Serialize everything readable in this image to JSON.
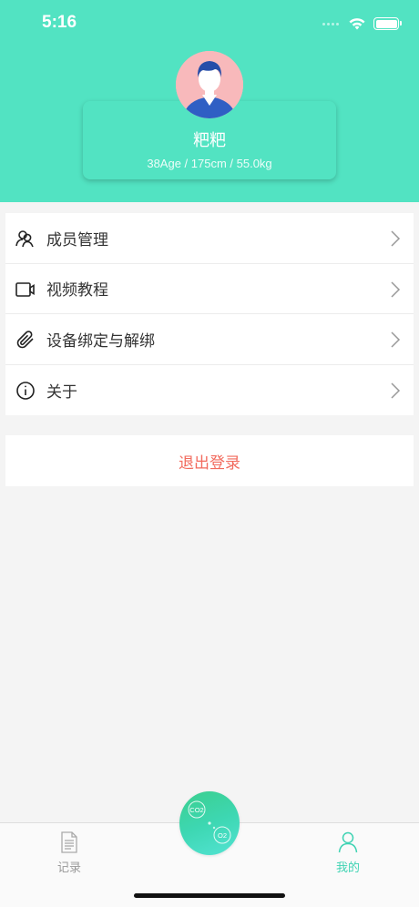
{
  "status_bar": {
    "time": "5:16"
  },
  "profile": {
    "name": "粑粑",
    "stats": "38Age / 175cm / 55.0kg"
  },
  "menu": {
    "items": [
      {
        "label": "成员管理",
        "icon": "members-icon"
      },
      {
        "label": "视频教程",
        "icon": "video-icon"
      },
      {
        "label": "设备绑定与解绑",
        "icon": "paperclip-icon"
      },
      {
        "label": "关于",
        "icon": "info-icon"
      }
    ]
  },
  "logout": {
    "label": "退出登录"
  },
  "tabbar": {
    "records_label": "记录",
    "mine_label": "我的",
    "center": {
      "co2": "CO2",
      "o2": "O2"
    }
  },
  "colors": {
    "header_bg": "#52e3c2",
    "logout_text": "#f26b5e",
    "active_tab": "#3fd3b3"
  }
}
